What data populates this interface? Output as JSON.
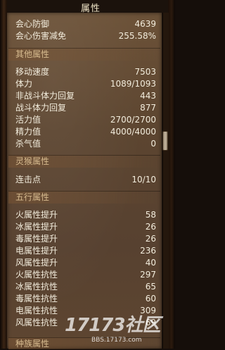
{
  "panel": {
    "title": "属性"
  },
  "top_rows": [
    {
      "label": "会心防御",
      "value": "4639"
    },
    {
      "label": "会心伤害减免",
      "value": "255.58%"
    }
  ],
  "sections": {
    "other": "其他属性",
    "spirit_monkey": "灵猴属性",
    "five_elements": "五行属性",
    "cut_off": "种族属性"
  },
  "other_rows": [
    {
      "label": "移动速度",
      "value": "7503"
    },
    {
      "label": "体力",
      "value": "1089/1093"
    },
    {
      "label": "非战斗体力回复",
      "value": "443"
    },
    {
      "label": "战斗体力回复",
      "value": "877"
    },
    {
      "label": "活力值",
      "value": "2700/2700"
    },
    {
      "label": "精力值",
      "value": "4000/4000"
    },
    {
      "label": "杀气值",
      "value": "0"
    }
  ],
  "monkey_rows": [
    {
      "label": "连击点",
      "value": "10/10"
    }
  ],
  "element_rows": [
    {
      "label": "火属性提升",
      "value": "58"
    },
    {
      "label": "冰属性提升",
      "value": "26"
    },
    {
      "label": "毒属性提升",
      "value": "26"
    },
    {
      "label": "电属性提升",
      "value": "236"
    },
    {
      "label": "风属性提升",
      "value": "40"
    },
    {
      "label": "火属性抗性",
      "value": "297"
    },
    {
      "label": "冰属性抗性",
      "value": "65"
    },
    {
      "label": "毒属性抗性",
      "value": "60"
    },
    {
      "label": "电属性抗性",
      "value": "309"
    },
    {
      "label": "风属性抗性",
      "value": "69"
    }
  ],
  "watermark": {
    "logo": "17173社区",
    "url": "BBS.17173.com"
  },
  "colors": {
    "panel": "#5c4530",
    "text": "#f2ecdc",
    "section": "#d7bb8f"
  }
}
